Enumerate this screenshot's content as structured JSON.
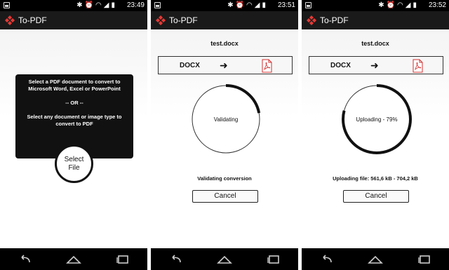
{
  "app": {
    "title": "To-PDF"
  },
  "screens": [
    {
      "time": "23:49",
      "tooltip": {
        "line1": "Select a PDF document to convert to",
        "line2": "Microsoft Word, Excel or PowerPoint",
        "or": "-- OR --",
        "line3": "Select any document or image type to",
        "line4": "convert to PDF"
      },
      "select_button": {
        "line1": "Select",
        "line2": "File"
      }
    },
    {
      "time": "23:51",
      "filename": "test.docx",
      "from_format": "DOCX",
      "arrow": "➜",
      "progress_label": "Validating",
      "progress_fraction": 0.22,
      "status": "Validating conversion",
      "cancel_label": "Cancel"
    },
    {
      "time": "23:52",
      "filename": "test.docx",
      "from_format": "DOCX",
      "arrow": "➜",
      "progress_label": "Uploading - 79%",
      "progress_fraction": 0.79,
      "status": "Uploading file: 561,6 kB - 704,2 kB",
      "cancel_label": "Cancel"
    }
  ],
  "statusbar_icons": [
    "bluetooth-icon",
    "alarm-icon",
    "wifi-icon",
    "signal-icon",
    "battery-icon"
  ],
  "navbar_icons": [
    "back-icon",
    "home-icon",
    "recents-icon"
  ],
  "colors": {
    "accent": "#e53935",
    "bar": "#1a1a1a",
    "ring": "#111111"
  }
}
